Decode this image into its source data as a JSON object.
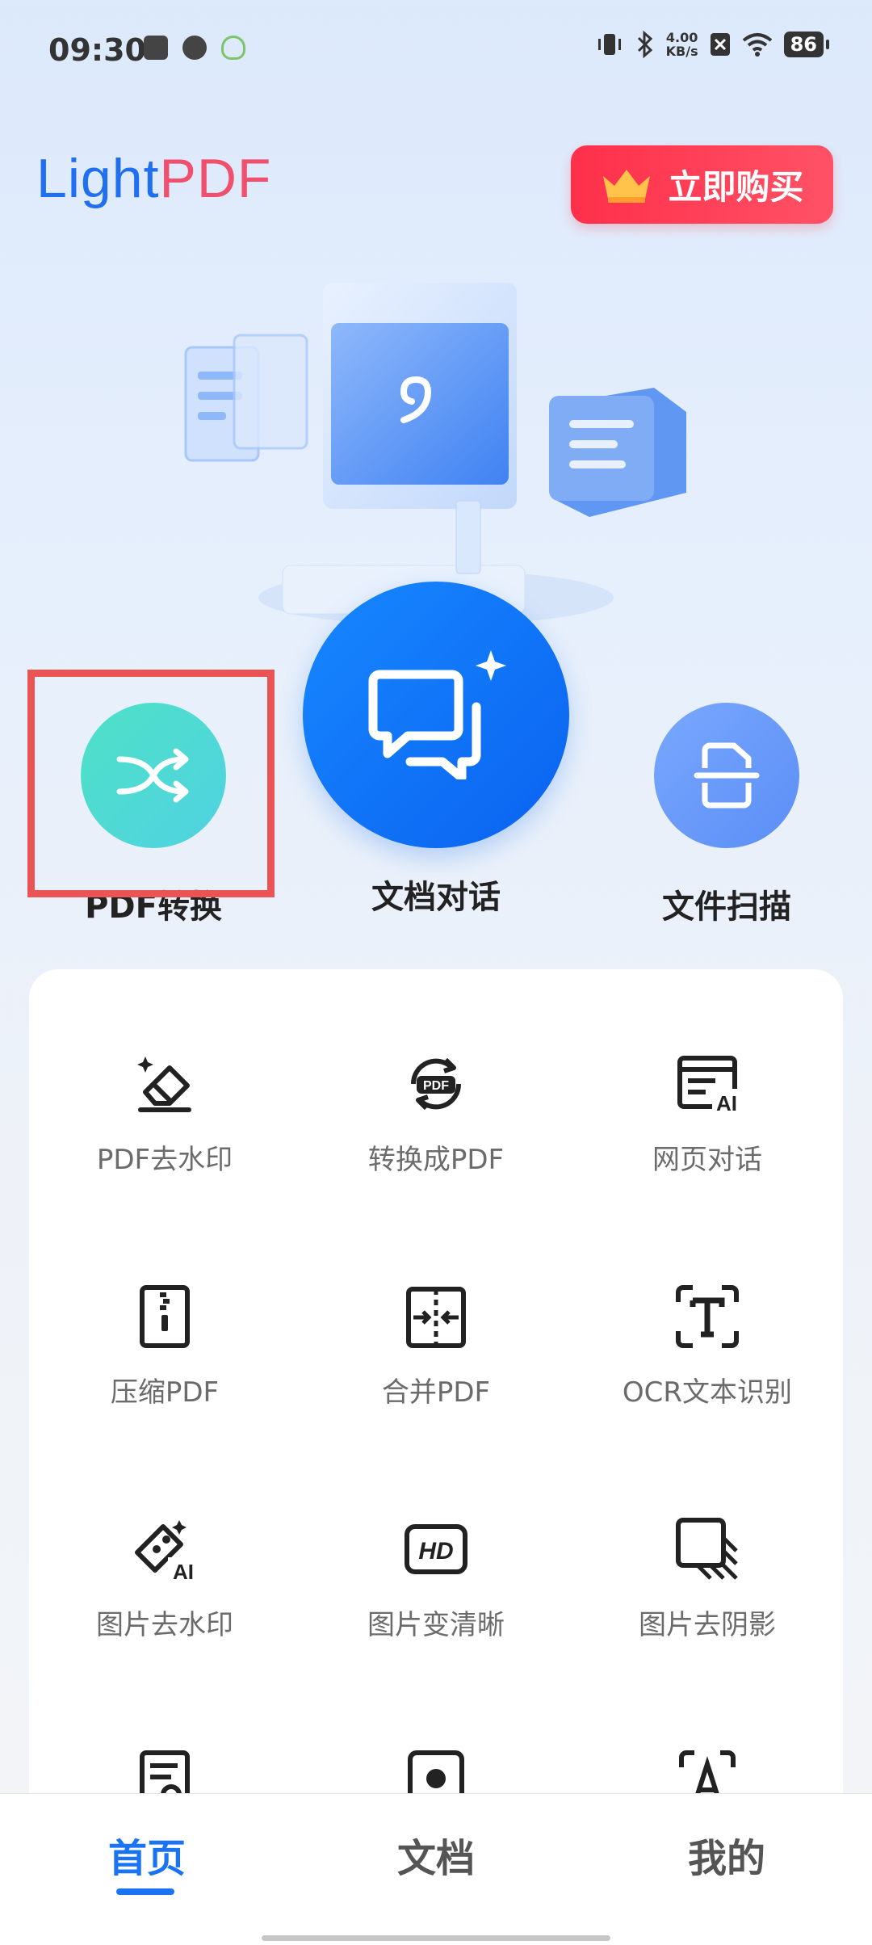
{
  "status_bar": {
    "time": "09:30",
    "net_speed_value": "4.00",
    "net_speed_unit": "KB/s",
    "battery": "86"
  },
  "header": {
    "logo_light": "Light",
    "logo_pdf": "PDF",
    "buy_label": "立即购买"
  },
  "features": {
    "convert_label": "PDF转换",
    "chat_label": "文档对话",
    "scan_label": "文件扫描"
  },
  "tools": [
    {
      "label": "PDF去水印",
      "icon": "eraser-icon"
    },
    {
      "label": "转换成PDF",
      "icon": "pdf-convert-icon"
    },
    {
      "label": "网页对话",
      "icon": "webpage-ai-icon"
    },
    {
      "label": "压缩PDF",
      "icon": "zip-icon"
    },
    {
      "label": "合并PDF",
      "icon": "merge-icon"
    },
    {
      "label": "OCR文本识别",
      "icon": "ocr-text-icon"
    },
    {
      "label": "图片去水印",
      "icon": "image-eraser-ai-icon"
    },
    {
      "label": "图片变清晰",
      "icon": "hd-icon"
    },
    {
      "label": "图片去阴影",
      "icon": "shadow-remove-icon"
    }
  ],
  "bottom_nav": {
    "home": "首页",
    "docs": "文档",
    "mine": "我的",
    "active": "home"
  },
  "colors": {
    "brand_blue": "#1f6ff0",
    "brand_pink": "#f0506e",
    "buy_red": "#ff3a52",
    "active_tab": "#1a73f2",
    "highlight_box": "#ea5455"
  }
}
